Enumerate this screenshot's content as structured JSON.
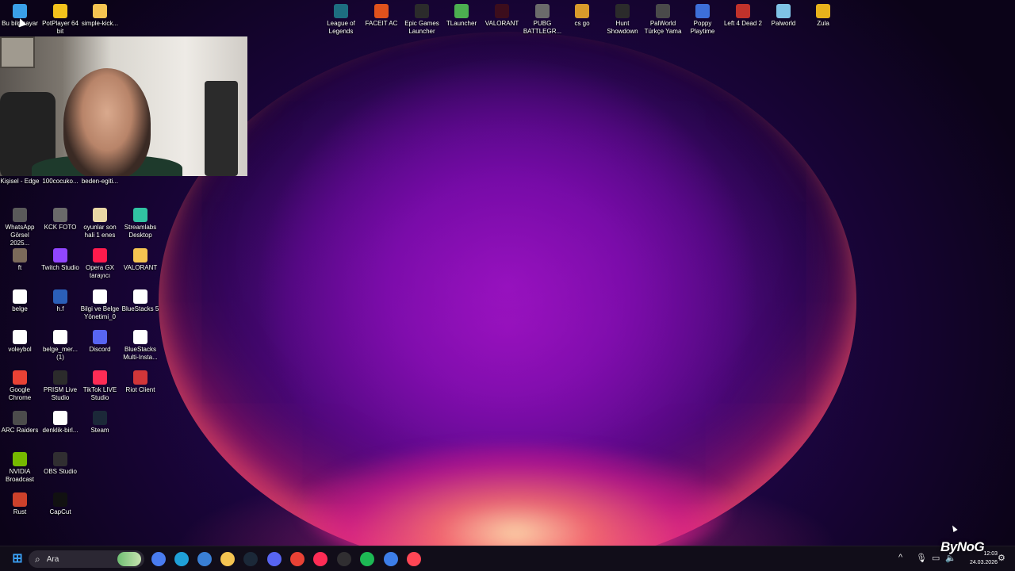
{
  "desktop": {
    "top_icons": [
      {
        "label": "Bu bilgisayar",
        "icon": "computer-icon",
        "color": "#3aa0e8"
      },
      {
        "label": "PotPlayer 64 bit",
        "icon": "potplayer-icon",
        "color": "#f2c21c"
      },
      {
        "label": "simple-kick...",
        "icon": "folder-icon",
        "color": "#f5c451"
      },
      {
        "label": "League of Legends",
        "icon": "league-of-legends-icon",
        "color": "#1d6e80"
      },
      {
        "label": "FACEIT AC",
        "icon": "faceit-icon",
        "color": "#e0521c"
      },
      {
        "label": "Epic Games Launcher",
        "icon": "epic-games-icon",
        "color": "#2b2b2b"
      },
      {
        "label": "TLauncher",
        "icon": "tlauncher-icon",
        "color": "#4caf50"
      },
      {
        "label": "VALORANT",
        "icon": "valorant-icon",
        "color": "#3c0d1c"
      },
      {
        "label": "PUBG BATTLEGR...",
        "icon": "pubg-icon",
        "color": "#6b6b6b"
      },
      {
        "label": "cs go",
        "icon": "csgo-icon",
        "color": "#d99b2b"
      },
      {
        "label": "Hunt Showdown",
        "icon": "hunt-showdown-icon",
        "color": "#2b2b2b"
      },
      {
        "label": "PalWorld Türkçe Yama",
        "icon": "palworld-tr-icon",
        "color": "#4a4a4a"
      },
      {
        "label": "Poppy Playtime",
        "icon": "poppy-playtime-icon",
        "color": "#3d6fd9"
      },
      {
        "label": "Left 4 Dead 2",
        "icon": "left4dead-icon",
        "color": "#c0322b"
      },
      {
        "label": "Palworld",
        "icon": "palworld-icon",
        "color": "#7fc3e6"
      },
      {
        "label": "Zula",
        "icon": "zula-icon",
        "color": "#e8b21c"
      }
    ],
    "under_cam": [
      {
        "label": "Kişisel - Edge",
        "icon": "edge-icon"
      },
      {
        "label": "100cocuko...",
        "icon": "document-icon"
      },
      {
        "label": "beden-egiti...",
        "icon": "document-icon"
      }
    ],
    "grid_icons": [
      {
        "label": "WhatsApp Görsel 2025...",
        "icon": "image-icon",
        "color": "#5a5a5a"
      },
      {
        "label": "KCK FOTO",
        "icon": "image-icon",
        "color": "#6a6a6a"
      },
      {
        "label": "oyunlar son hali 1 enes",
        "icon": "folder-icon",
        "color": "#e9d7a5"
      },
      {
        "label": "Streamlabs Desktop",
        "icon": "streamlabs-icon",
        "color": "#31c3a2"
      },
      {
        "label": "ft",
        "icon": "image-icon",
        "color": "#7b6a5a"
      },
      {
        "label": "Twitch Studio",
        "icon": "twitch-icon",
        "color": "#9146ff"
      },
      {
        "label": "Opera GX tarayıcı",
        "icon": "opera-gx-icon",
        "color": "#ff1b4c"
      },
      {
        "label": "VALORANT",
        "icon": "folder-icon",
        "color": "#f5c451"
      },
      {
        "label": "belge",
        "icon": "chrome-doc-icon",
        "color": "#ffffff"
      },
      {
        "label": "h.f",
        "icon": "word-doc-icon",
        "color": "#2b5fb8"
      },
      {
        "label": "Bilgi ve Belge Yönetimi_0",
        "icon": "chrome-doc-icon",
        "color": "#ffffff"
      },
      {
        "label": "BlueStacks 5",
        "icon": "document-icon",
        "color": "#ffffff"
      },
      {
        "label": "voleybol",
        "icon": "chrome-doc-icon",
        "color": "#ffffff"
      },
      {
        "label": "belge_mer... (1)",
        "icon": "chrome-doc-icon",
        "color": "#ffffff"
      },
      {
        "label": "Discord",
        "icon": "discord-icon",
        "color": "#5865f2"
      },
      {
        "label": "BlueStacks Multi-Insta...",
        "icon": "document-icon",
        "color": "#ffffff"
      },
      {
        "label": "Google Chrome",
        "icon": "chrome-icon",
        "color": "#e94235"
      },
      {
        "label": "PRISM Live Studio",
        "icon": "prism-icon",
        "color": "#2b2b2b"
      },
      {
        "label": "TikTok LIVE Studio",
        "icon": "tiktok-icon",
        "color": "#fe2c55"
      },
      {
        "label": "Riot Client",
        "icon": "riot-icon",
        "color": "#d13639"
      },
      {
        "label": "ARC Raiders",
        "icon": "arc-raiders-icon",
        "color": "#4c4c4c"
      },
      {
        "label": "denklik-birl...",
        "icon": "chrome-doc-icon",
        "color": "#ffffff"
      },
      {
        "label": "Steam",
        "icon": "steam-icon",
        "color": "#1b2838"
      },
      {
        "label": "NVIDIA Broadcast",
        "icon": "nvidia-icon",
        "color": "#76b900"
      },
      {
        "label": "OBS Studio",
        "icon": "obs-icon",
        "color": "#302e31"
      },
      {
        "label": "Rust",
        "icon": "rust-icon",
        "color": "#cd412b"
      },
      {
        "label": "CapCut",
        "icon": "capcut-icon",
        "color": "#111111"
      }
    ]
  },
  "taskbar": {
    "search_placeholder": "Ara",
    "apps": [
      {
        "name": "copilot",
        "icon": "copilot-icon",
        "color": "#4a7cf0"
      },
      {
        "name": "edge",
        "icon": "edge-icon",
        "color": "#1fa0d8"
      },
      {
        "name": "store",
        "icon": "store-icon",
        "color": "#3a7fd5"
      },
      {
        "name": "explorer",
        "icon": "folder-icon",
        "color": "#f5c451"
      },
      {
        "name": "steam",
        "icon": "steam-icon",
        "color": "#1b2838"
      },
      {
        "name": "discord",
        "icon": "discord-icon",
        "color": "#5865f2"
      },
      {
        "name": "chrome",
        "icon": "chrome-icon",
        "color": "#e94235"
      },
      {
        "name": "tiktok",
        "icon": "tiktok-icon",
        "color": "#fe2c55"
      },
      {
        "name": "obs",
        "icon": "obs-icon",
        "color": "#302e31"
      },
      {
        "name": "spotify",
        "icon": "spotify-icon",
        "color": "#1db954"
      },
      {
        "name": "chrome-profile",
        "icon": "chrome-icon",
        "color": "#3d7ee8"
      },
      {
        "name": "valorant",
        "icon": "valorant-icon",
        "color": "#ff4655"
      }
    ],
    "tray": {
      "chevron": "^",
      "time": "12:03",
      "date": "24.03.2026"
    }
  },
  "watermark": "ByNoG"
}
